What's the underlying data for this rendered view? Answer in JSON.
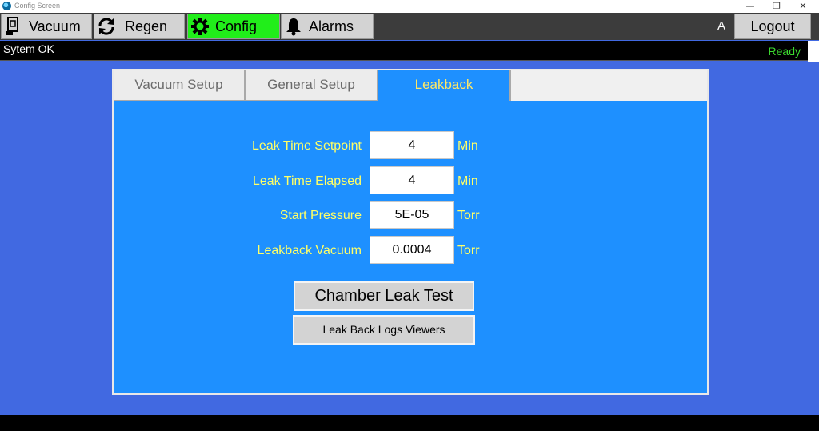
{
  "window": {
    "title": "Config Screen",
    "controls": {
      "minimize": "—",
      "restore": "❐",
      "close": "✕"
    }
  },
  "nav": {
    "buttons": [
      {
        "label": "Vacuum",
        "icon": "gauge-icon",
        "active": false
      },
      {
        "label": "Regen",
        "icon": "refresh-icon",
        "active": false
      },
      {
        "label": "Config",
        "icon": "gear-icon",
        "active": true
      },
      {
        "label": "Alarms",
        "icon": "bell-icon",
        "active": false
      }
    ],
    "user_label": "A",
    "logout_label": "Logout",
    "active_color": "#21ee1a"
  },
  "status": {
    "text": "Sytem OK",
    "ready_text": "Ready",
    "ready_color": "#3ddc2f"
  },
  "tabs": [
    {
      "label": "Vacuum Setup",
      "active": false
    },
    {
      "label": "General Setup",
      "active": false
    },
    {
      "label": "Leakback",
      "active": true
    }
  ],
  "leakback": {
    "fields": [
      {
        "label": "Leak Time Setpoint",
        "value": "4",
        "unit": "Min"
      },
      {
        "label": "Leak Time Elapsed",
        "value": "4",
        "unit": "Min"
      },
      {
        "label": "Start Pressure",
        "value": "5E-05",
        "unit": "Torr"
      },
      {
        "label": "Leakback Vacuum",
        "value": "0.0004",
        "unit": "Torr"
      }
    ],
    "chamber_leak_test_label": "Chamber Leak Test",
    "logs_viewer_label": "Leak Back Logs Viewers"
  },
  "colors": {
    "background": "#4169e1",
    "panel": "#1e90ff",
    "label_text": "#ffff66",
    "active_tab_text": "#ffe866"
  }
}
